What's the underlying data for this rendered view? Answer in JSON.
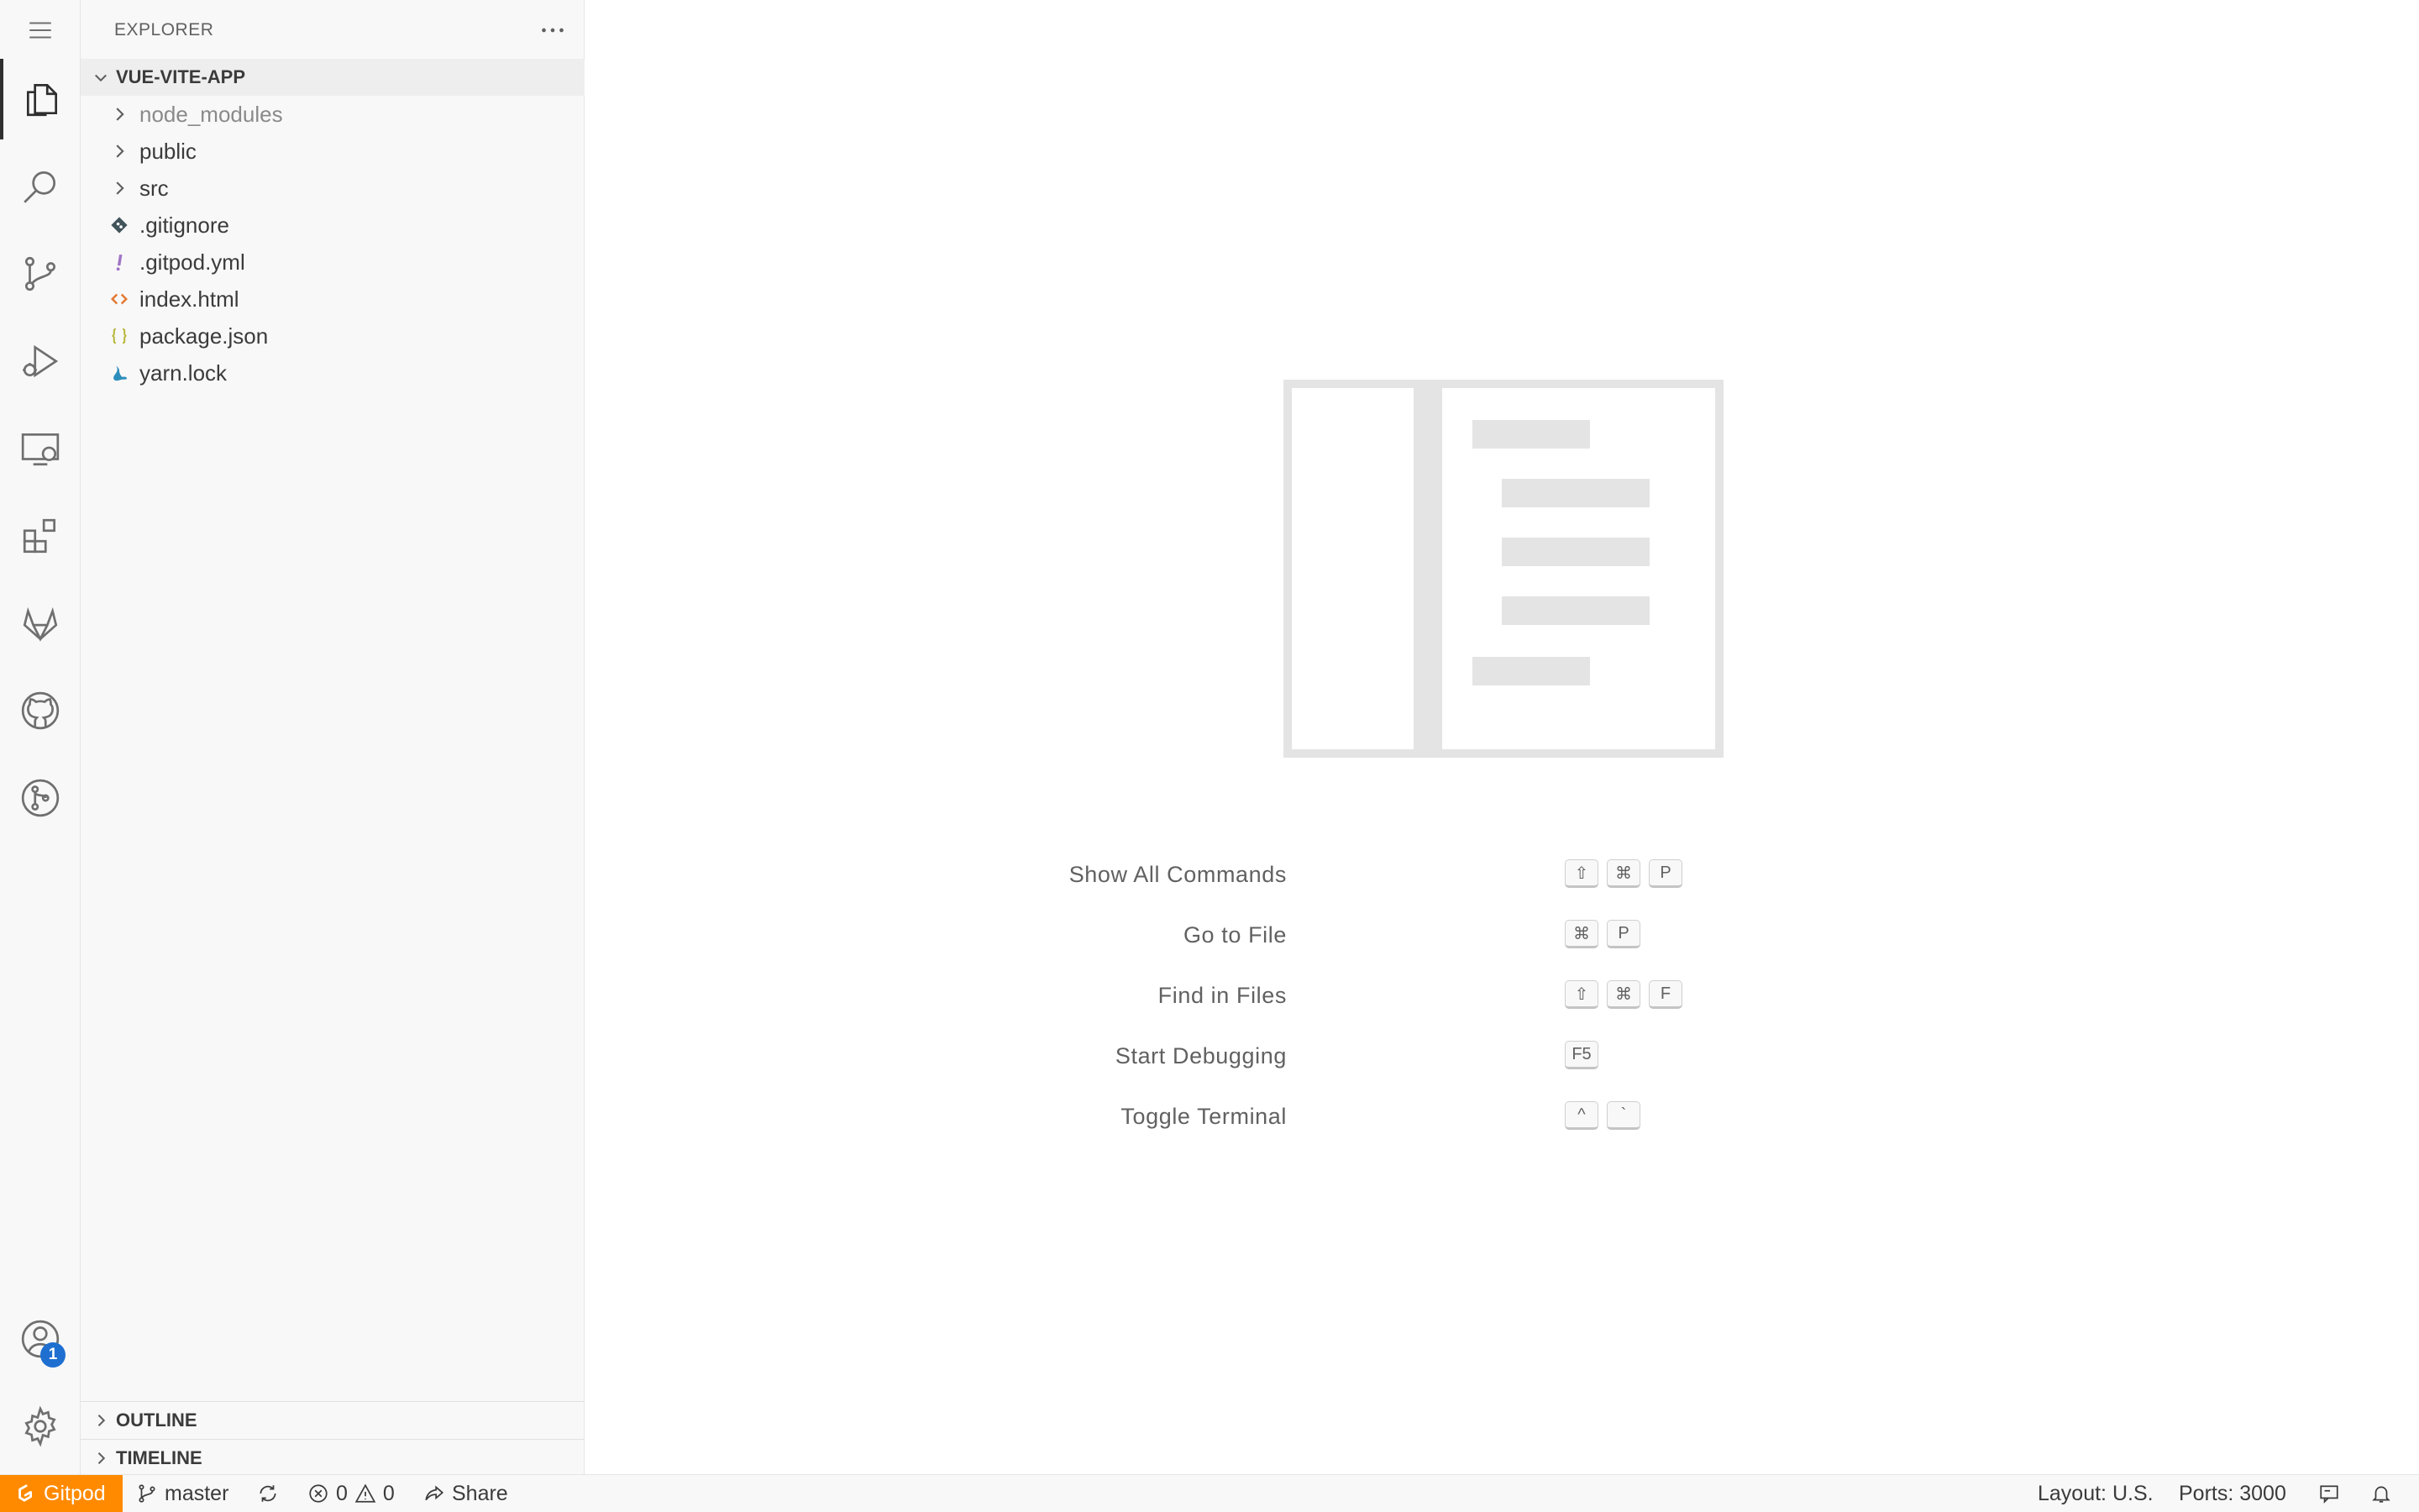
{
  "explorer": {
    "title": "EXPLORER",
    "project": "VUE-VITE-APP",
    "items": [
      {
        "label": "node_modules",
        "icon": "chevron-right-icon",
        "type": "folder",
        "dim": true
      },
      {
        "label": "public",
        "icon": "chevron-right-icon",
        "type": "folder"
      },
      {
        "label": "src",
        "icon": "chevron-right-icon",
        "type": "folder"
      },
      {
        "label": ".gitignore",
        "icon": "git-file-icon",
        "type": "file"
      },
      {
        "label": ".gitpod.yml",
        "icon": "yaml-file-icon",
        "type": "file"
      },
      {
        "label": "index.html",
        "icon": "html-file-icon",
        "type": "file"
      },
      {
        "label": "package.json",
        "icon": "json-file-icon",
        "type": "file"
      },
      {
        "label": "yarn.lock",
        "icon": "yarn-file-icon",
        "type": "file"
      }
    ],
    "outline": "OUTLINE",
    "timeline": "TIMELINE"
  },
  "activity_bar": {
    "items": [
      "menu-icon",
      "explorer-icon",
      "search-icon",
      "source-control-icon",
      "run-debug-icon",
      "remote-explorer-icon",
      "extensions-icon",
      "gitlab-icon",
      "github-icon",
      "git-graph-icon"
    ],
    "accounts_badge": "1"
  },
  "editor": {
    "shortcuts": [
      {
        "label": "Show All Commands",
        "keys": [
          "⇧",
          "⌘",
          "P"
        ]
      },
      {
        "label": "Go to File",
        "keys": [
          "⌘",
          "P"
        ]
      },
      {
        "label": "Find in Files",
        "keys": [
          "⇧",
          "⌘",
          "F"
        ]
      },
      {
        "label": "Start Debugging",
        "keys": [
          "F5"
        ]
      },
      {
        "label": "Toggle Terminal",
        "keys": [
          "^",
          "`"
        ]
      }
    ]
  },
  "status_bar": {
    "gitpod": "Gitpod",
    "branch": "master",
    "errors": "0",
    "warnings": "0",
    "share": "Share",
    "layout": "Layout: U.S.",
    "ports": "Ports: 3000"
  },
  "colors": {
    "gitpod_orange": "#ff8a00",
    "badge_blue": "#1f6fd1",
    "html_icon": "#e37933",
    "json_icon": "#b7b73b",
    "yaml_icon": "#a074c4",
    "yarn_icon": "#2c8ebb"
  }
}
